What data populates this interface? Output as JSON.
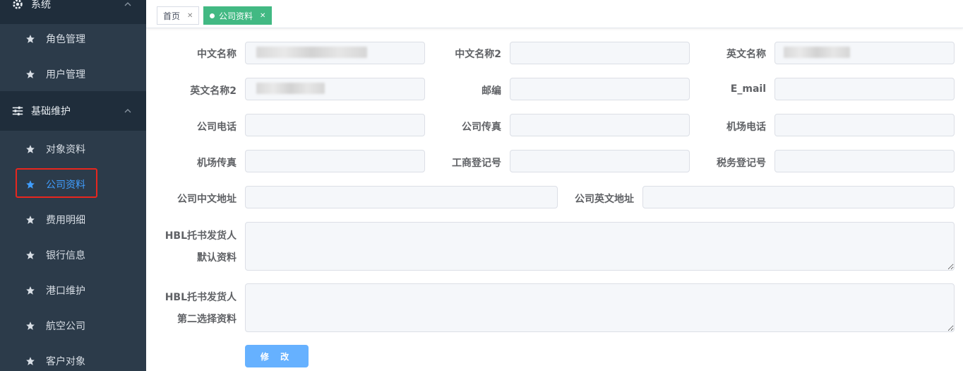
{
  "sidebar": {
    "groups": [
      {
        "label": "系统",
        "icon": "gear-icon"
      },
      {
        "label": "基础维护",
        "icon": "sliders-icon"
      }
    ],
    "items": [
      {
        "label": "角色管理"
      },
      {
        "label": "用户管理"
      },
      {
        "label": "对象资料"
      },
      {
        "label": "公司资料",
        "active": true
      },
      {
        "label": "费用明细"
      },
      {
        "label": "银行信息"
      },
      {
        "label": "港口维护"
      },
      {
        "label": "航空公司"
      },
      {
        "label": "客户对象"
      }
    ]
  },
  "tabs": [
    {
      "label": "首页",
      "active": false
    },
    {
      "label": "公司资料",
      "active": true
    }
  ],
  "form": {
    "cn_name": {
      "label": "中文名称",
      "value": ""
    },
    "cn_name2": {
      "label": "中文名称2",
      "value": ""
    },
    "en_name": {
      "label": "英文名称",
      "value": ""
    },
    "en_name2": {
      "label": "英文名称2",
      "value": ""
    },
    "postcode": {
      "label": "邮编",
      "value": ""
    },
    "email": {
      "label": "E_mail",
      "value": ""
    },
    "phone": {
      "label": "公司电话",
      "value": ""
    },
    "fax": {
      "label": "公司传真",
      "value": ""
    },
    "airport_phone": {
      "label": "机场电话",
      "value": ""
    },
    "airport_fax": {
      "label": "机场传真",
      "value": ""
    },
    "business_reg": {
      "label": "工商登记号",
      "value": ""
    },
    "tax_reg": {
      "label": "税务登记号",
      "value": ""
    },
    "cn_address": {
      "label": "公司中文地址",
      "value": ""
    },
    "en_address": {
      "label": "公司英文地址",
      "value": ""
    },
    "hbl_default": {
      "label_line1": "HBL托书发货人",
      "label_line2": "默认资料"
    },
    "hbl_second": {
      "label_line1": "HBL托书发货人",
      "label_line2": "第二选择资料"
    },
    "submit_label": "修 改"
  },
  "colors": {
    "sidebar_bg": "#2c3b4a",
    "active_text": "#409eff",
    "tab_active": "#42b983",
    "button": "#66b1ff",
    "highlight": "#e8261e"
  }
}
